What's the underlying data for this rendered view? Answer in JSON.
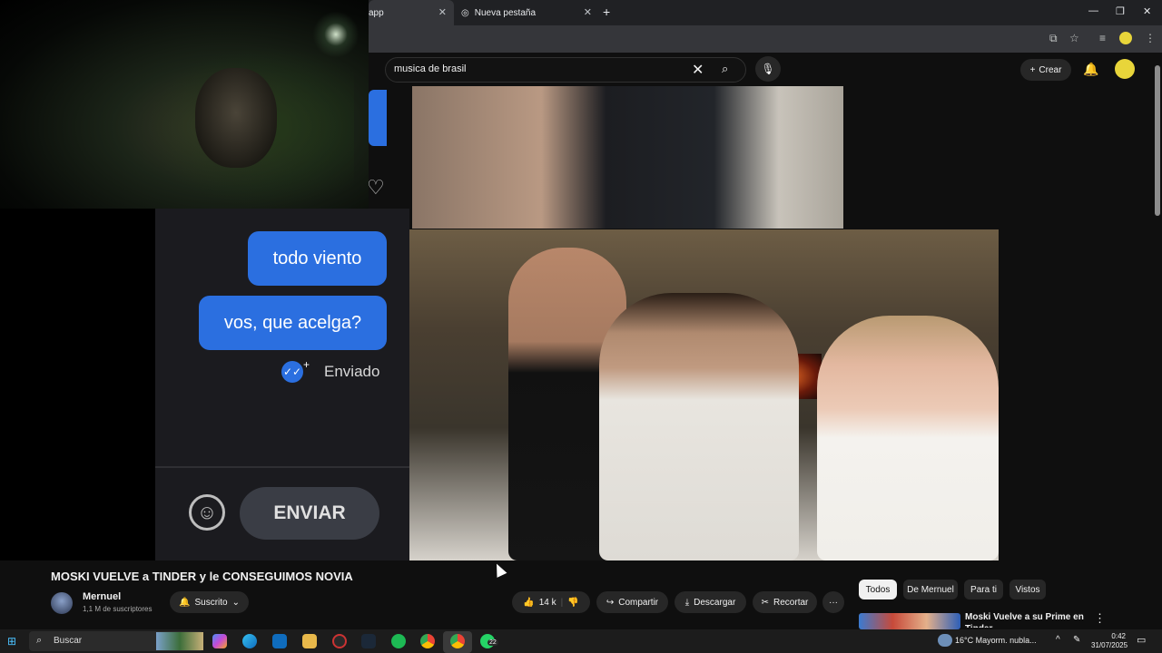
{
  "browser": {
    "tab1_label": "app",
    "tab2_label": "Nueva pestaña",
    "new_tab": "+",
    "close": "✕",
    "win_min": "—",
    "win_restore": "❐",
    "win_close": "✕"
  },
  "youtube": {
    "search_value": "musica de brasil",
    "create_label": "Crear",
    "video_title": "MOSKI VUELVE a TINDER y le CONSEGUIMOS NOVIA",
    "channel_name": "Mernuel",
    "subscribers": "1,1 M de suscriptores",
    "subscribed_label": "Suscrito",
    "likes": "14 k",
    "share_label": "Compartir",
    "download_label": "Descargar",
    "clip_label": "Recortar",
    "more_label": "···",
    "chips": [
      "Todos",
      "De Mernuel",
      "Para ti",
      "Vistos"
    ],
    "recommended_title": "Moski Vuelve a su Prime en Tinder",
    "accent": "#ff0000"
  },
  "chat": {
    "message1": "todo viento",
    "message2": "vos, que acelga?",
    "status": "Enviado",
    "send_button": "ENVIAR",
    "bubble_color": "#2b6fe0"
  },
  "taskbar": {
    "search_placeholder": "Buscar",
    "whatsapp_badge": "22",
    "weather": "16°C  Mayorm. nubla...",
    "time": "0:42",
    "date": "31/07/2025"
  },
  "icons": {
    "search": "search-icon",
    "mic": "mic-icon",
    "bell": "bell-icon",
    "like": "thumbs-up-icon",
    "dislike": "thumbs-down-icon",
    "share": "share-icon",
    "download": "download-icon",
    "clip": "scissors-icon",
    "heart": "heart-icon",
    "emoji": "emoji-icon"
  }
}
